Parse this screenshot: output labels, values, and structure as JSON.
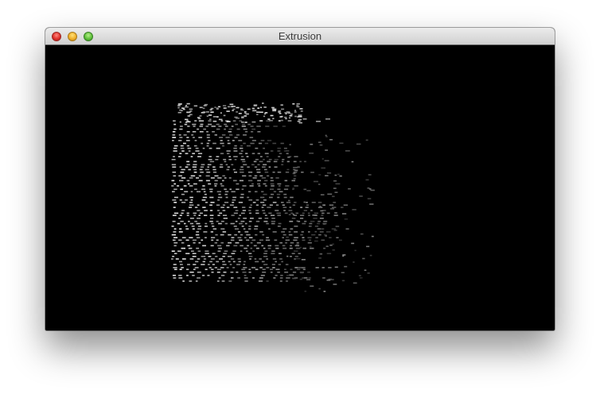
{
  "window": {
    "title": "Extrusion",
    "buttons": {
      "close": "close-icon",
      "minimize": "minimize-icon",
      "zoom": "zoom-icon"
    }
  },
  "colors": {
    "titlebar_top": "#ececec",
    "titlebar_bottom": "#d0d0d0",
    "viewport_background": "#000000",
    "close": "#e0302a",
    "minimize": "#f0b02b",
    "zoom": "#5fc03a"
  }
}
